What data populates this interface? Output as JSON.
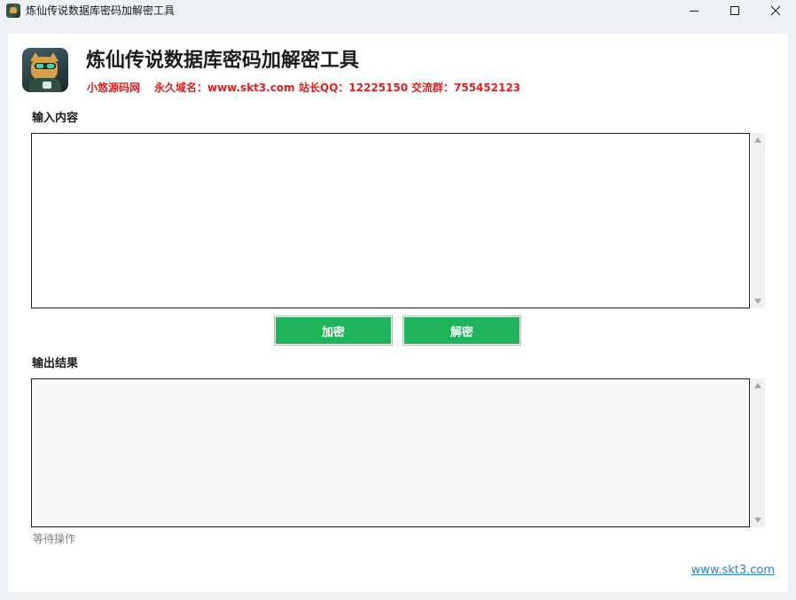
{
  "window": {
    "title": "炼仙传说数据库密码加解密工具",
    "icon": "cat-logo-icon"
  },
  "header": {
    "title": "炼仙传说数据库密码加解密工具",
    "info": [
      "小悠源码网",
      "永久域名：www.skt3.com",
      "站长QQ：12225150",
      "交流群：755452123"
    ],
    "info_color": "#e0201e"
  },
  "input_section": {
    "label": "输入内容",
    "value": "",
    "placeholder": ""
  },
  "buttons": {
    "encrypt_label": "加密",
    "decrypt_label": "解密",
    "color": "#20b45a"
  },
  "output_section": {
    "label": "输出结果",
    "value": "",
    "placeholder": ""
  },
  "status": {
    "text": "等待操作"
  },
  "footer": {
    "link_text": "www.skt3.com",
    "link_color": "#2a7fc9"
  }
}
